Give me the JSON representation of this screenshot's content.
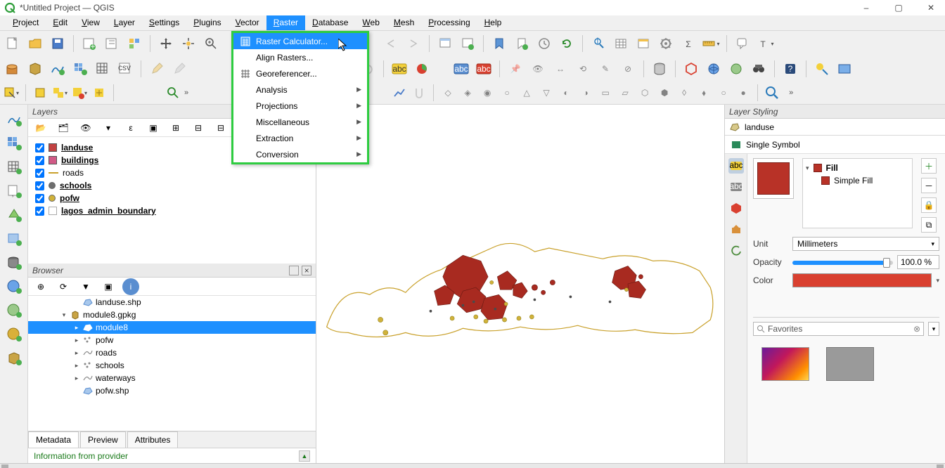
{
  "window": {
    "title": "*Untitled Project — QGIS"
  },
  "menubar": {
    "items": [
      "Project",
      "Edit",
      "View",
      "Layer",
      "Settings",
      "Plugins",
      "Vector",
      "Raster",
      "Database",
      "Web",
      "Mesh",
      "Processing",
      "Help"
    ],
    "active_index": 7
  },
  "raster_menu": {
    "items": [
      {
        "label": "Raster Calculator...",
        "icon": "calculator",
        "submenu": false,
        "highlight": true
      },
      {
        "label": "Align Rasters...",
        "icon": "",
        "submenu": false
      },
      {
        "label": "Georeferencer...",
        "icon": "grid",
        "submenu": false
      },
      {
        "label": "Analysis",
        "icon": "",
        "submenu": true
      },
      {
        "label": "Projections",
        "icon": "",
        "submenu": true
      },
      {
        "label": "Miscellaneous",
        "icon": "",
        "submenu": true
      },
      {
        "label": "Extraction",
        "icon": "",
        "submenu": true
      },
      {
        "label": "Conversion",
        "icon": "",
        "submenu": true
      }
    ]
  },
  "layers_panel": {
    "title": "Layers",
    "layers": [
      {
        "name": "landuse",
        "checked": true,
        "style": "fill",
        "color": "#c24141",
        "bold": true
      },
      {
        "name": "buildings",
        "checked": true,
        "style": "fill",
        "color": "#d15a86",
        "bold": true
      },
      {
        "name": "roads",
        "checked": true,
        "style": "line",
        "color": "#c9a12c",
        "bold": false
      },
      {
        "name": "schools",
        "checked": true,
        "style": "circle",
        "color": "#6e6e6e",
        "bold": true
      },
      {
        "name": "pofw",
        "checked": true,
        "style": "circle",
        "color": "#d0b23a",
        "bold": true
      },
      {
        "name": "lagos_admin_boundary",
        "checked": true,
        "style": "outline",
        "color": "#ffffff",
        "bold": true
      }
    ]
  },
  "browser_panel": {
    "title": "Browser",
    "tree": [
      {
        "indent": 3,
        "caret": "",
        "icon": "shp",
        "label": "landuse.shp",
        "selected": false
      },
      {
        "indent": 2,
        "caret": "▾",
        "icon": "gpkg",
        "label": "module8.gpkg",
        "selected": false
      },
      {
        "indent": 3,
        "caret": "▸",
        "icon": "poly",
        "label": "module8",
        "selected": true
      },
      {
        "indent": 3,
        "caret": "▸",
        "icon": "point",
        "label": "pofw",
        "selected": false
      },
      {
        "indent": 3,
        "caret": "▸",
        "icon": "line",
        "label": "roads",
        "selected": false
      },
      {
        "indent": 3,
        "caret": "▸",
        "icon": "point",
        "label": "schools",
        "selected": false
      },
      {
        "indent": 3,
        "caret": "▸",
        "icon": "line",
        "label": "waterways",
        "selected": false
      },
      {
        "indent": 3,
        "caret": "",
        "icon": "shp",
        "label": "pofw.shp",
        "selected": false
      }
    ],
    "tabs": [
      "Metadata",
      "Preview",
      "Attributes"
    ],
    "active_tab": 0,
    "info_text": "Information from provider"
  },
  "layer_styling": {
    "title": "Layer Styling",
    "layer_name": "landuse",
    "symbol_type": "Single Symbol",
    "fill_tree": {
      "root": "Fill",
      "child": "Simple Fill",
      "fill_color": "#b83227"
    },
    "unit_label": "Unit",
    "unit_value": "Millimeters",
    "opacity_label": "Opacity",
    "opacity_value": "100.0 %",
    "opacity_percent": 92,
    "color_label": "Color",
    "color_value": "#d94030",
    "favorites_placeholder": "Favorites"
  },
  "icons": {
    "minimize": "–",
    "maximize": "▢",
    "close": "✕"
  }
}
